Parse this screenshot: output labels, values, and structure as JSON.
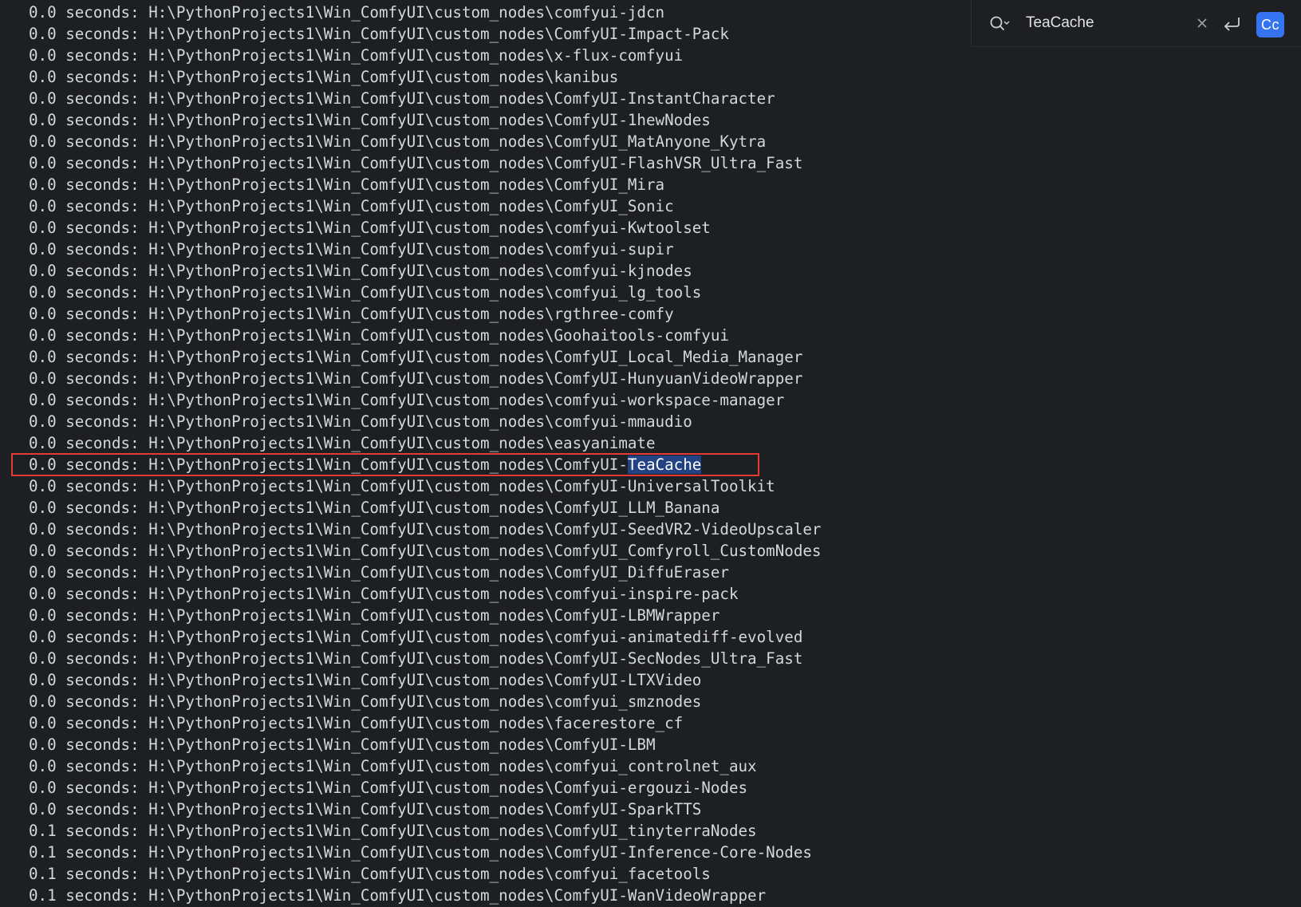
{
  "search": {
    "query": "TeaCache",
    "match_case_label": "Cc",
    "icons": {
      "search": "search-history-icon",
      "clear": "close-icon",
      "newline": "newline-icon"
    }
  },
  "highlight_colors": {
    "match_background": "#214283",
    "current_result_box": "#e53935",
    "match_case_active": "#3574f0"
  },
  "console": {
    "lines": [
      {
        "time": "0.0",
        "path": "H:\\PythonProjects1\\Win_ComfyUI\\custom_nodes\\comfyui-jdcn"
      },
      {
        "time": "0.0",
        "path": "H:\\PythonProjects1\\Win_ComfyUI\\custom_nodes\\ComfyUI-Impact-Pack"
      },
      {
        "time": "0.0",
        "path": "H:\\PythonProjects1\\Win_ComfyUI\\custom_nodes\\x-flux-comfyui"
      },
      {
        "time": "0.0",
        "path": "H:\\PythonProjects1\\Win_ComfyUI\\custom_nodes\\kanibus"
      },
      {
        "time": "0.0",
        "path": "H:\\PythonProjects1\\Win_ComfyUI\\custom_nodes\\ComfyUI-InstantCharacter"
      },
      {
        "time": "0.0",
        "path": "H:\\PythonProjects1\\Win_ComfyUI\\custom_nodes\\ComfyUI-1hewNodes"
      },
      {
        "time": "0.0",
        "path": "H:\\PythonProjects1\\Win_ComfyUI\\custom_nodes\\ComfyUI_MatAnyone_Kytra"
      },
      {
        "time": "0.0",
        "path": "H:\\PythonProjects1\\Win_ComfyUI\\custom_nodes\\ComfyUI-FlashVSR_Ultra_Fast"
      },
      {
        "time": "0.0",
        "path": "H:\\PythonProjects1\\Win_ComfyUI\\custom_nodes\\ComfyUI_Mira"
      },
      {
        "time": "0.0",
        "path": "H:\\PythonProjects1\\Win_ComfyUI\\custom_nodes\\ComfyUI_Sonic"
      },
      {
        "time": "0.0",
        "path": "H:\\PythonProjects1\\Win_ComfyUI\\custom_nodes\\comfyui-Kwtoolset"
      },
      {
        "time": "0.0",
        "path": "H:\\PythonProjects1\\Win_ComfyUI\\custom_nodes\\comfyui-supir"
      },
      {
        "time": "0.0",
        "path": "H:\\PythonProjects1\\Win_ComfyUI\\custom_nodes\\comfyui-kjnodes"
      },
      {
        "time": "0.0",
        "path": "H:\\PythonProjects1\\Win_ComfyUI\\custom_nodes\\comfyui_lg_tools"
      },
      {
        "time": "0.0",
        "path": "H:\\PythonProjects1\\Win_ComfyUI\\custom_nodes\\rgthree-comfy"
      },
      {
        "time": "0.0",
        "path": "H:\\PythonProjects1\\Win_ComfyUI\\custom_nodes\\Goohaitools-comfyui"
      },
      {
        "time": "0.0",
        "path": "H:\\PythonProjects1\\Win_ComfyUI\\custom_nodes\\ComfyUI_Local_Media_Manager"
      },
      {
        "time": "0.0",
        "path": "H:\\PythonProjects1\\Win_ComfyUI\\custom_nodes\\ComfyUI-HunyuanVideoWrapper"
      },
      {
        "time": "0.0",
        "path": "H:\\PythonProjects1\\Win_ComfyUI\\custom_nodes\\comfyui-workspace-manager"
      },
      {
        "time": "0.0",
        "path": "H:\\PythonProjects1\\Win_ComfyUI\\custom_nodes\\comfyui-mmaudio"
      },
      {
        "time": "0.0",
        "path": "H:\\PythonProjects1\\Win_ComfyUI\\custom_nodes\\easyanimate"
      },
      {
        "time": "0.0",
        "path": "H:\\PythonProjects1\\Win_ComfyUI\\custom_nodes\\ComfyUI-TeaCache",
        "current": true
      },
      {
        "time": "0.0",
        "path": "H:\\PythonProjects1\\Win_ComfyUI\\custom_nodes\\ComfyUI-UniversalToolkit"
      },
      {
        "time": "0.0",
        "path": "H:\\PythonProjects1\\Win_ComfyUI\\custom_nodes\\ComfyUI_LLM_Banana"
      },
      {
        "time": "0.0",
        "path": "H:\\PythonProjects1\\Win_ComfyUI\\custom_nodes\\ComfyUI-SeedVR2-VideoUpscaler"
      },
      {
        "time": "0.0",
        "path": "H:\\PythonProjects1\\Win_ComfyUI\\custom_nodes\\ComfyUI_Comfyroll_CustomNodes"
      },
      {
        "time": "0.0",
        "path": "H:\\PythonProjects1\\Win_ComfyUI\\custom_nodes\\ComfyUI_DiffuEraser"
      },
      {
        "time": "0.0",
        "path": "H:\\PythonProjects1\\Win_ComfyUI\\custom_nodes\\comfyui-inspire-pack"
      },
      {
        "time": "0.0",
        "path": "H:\\PythonProjects1\\Win_ComfyUI\\custom_nodes\\ComfyUI-LBMWrapper"
      },
      {
        "time": "0.0",
        "path": "H:\\PythonProjects1\\Win_ComfyUI\\custom_nodes\\comfyui-animatediff-evolved"
      },
      {
        "time": "0.0",
        "path": "H:\\PythonProjects1\\Win_ComfyUI\\custom_nodes\\ComfyUI-SecNodes_Ultra_Fast"
      },
      {
        "time": "0.0",
        "path": "H:\\PythonProjects1\\Win_ComfyUI\\custom_nodes\\ComfyUI-LTXVideo"
      },
      {
        "time": "0.0",
        "path": "H:\\PythonProjects1\\Win_ComfyUI\\custom_nodes\\comfyui_smznodes"
      },
      {
        "time": "0.0",
        "path": "H:\\PythonProjects1\\Win_ComfyUI\\custom_nodes\\facerestore_cf"
      },
      {
        "time": "0.0",
        "path": "H:\\PythonProjects1\\Win_ComfyUI\\custom_nodes\\ComfyUI-LBM"
      },
      {
        "time": "0.0",
        "path": "H:\\PythonProjects1\\Win_ComfyUI\\custom_nodes\\comfyui_controlnet_aux"
      },
      {
        "time": "0.0",
        "path": "H:\\PythonProjects1\\Win_ComfyUI\\custom_nodes\\Comfyui-ergouzi-Nodes"
      },
      {
        "time": "0.0",
        "path": "H:\\PythonProjects1\\Win_ComfyUI\\custom_nodes\\ComfyUI-SparkTTS"
      },
      {
        "time": "0.1",
        "path": "H:\\PythonProjects1\\Win_ComfyUI\\custom_nodes\\ComfyUI_tinyterraNodes"
      },
      {
        "time": "0.1",
        "path": "H:\\PythonProjects1\\Win_ComfyUI\\custom_nodes\\ComfyUI-Inference-Core-Nodes"
      },
      {
        "time": "0.1",
        "path": "H:\\PythonProjects1\\Win_ComfyUI\\custom_nodes\\comfyui_facetools"
      },
      {
        "time": "0.1",
        "path": "H:\\PythonProjects1\\Win_ComfyUI\\custom_nodes\\ComfyUI-WanVideoWrapper"
      }
    ]
  }
}
